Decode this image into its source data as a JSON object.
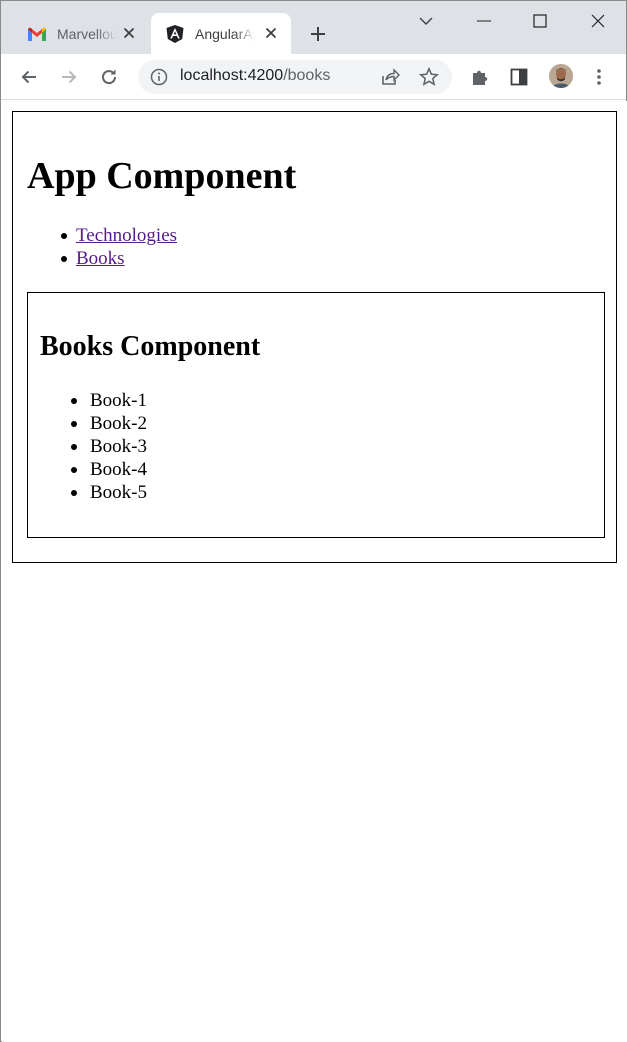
{
  "browser": {
    "tabs": [
      {
        "title": "Marvellous Mail",
        "favicon": "gmail-icon",
        "active": false
      },
      {
        "title": "AngularApp",
        "favicon": "angular-icon",
        "active": true
      }
    ],
    "address": {
      "host": "localhost:4200",
      "path": "/books"
    }
  },
  "page": {
    "app_heading": "App Component",
    "nav_links": [
      {
        "label": "Technologies"
      },
      {
        "label": "Books"
      }
    ],
    "books_component": {
      "heading": "Books Component",
      "items": [
        "Book-1",
        "Book-2",
        "Book-3",
        "Book-4",
        "Book-5"
      ]
    }
  },
  "colors": {
    "tabstrip": "#dee1e6",
    "visited_link": "#551a8b"
  }
}
